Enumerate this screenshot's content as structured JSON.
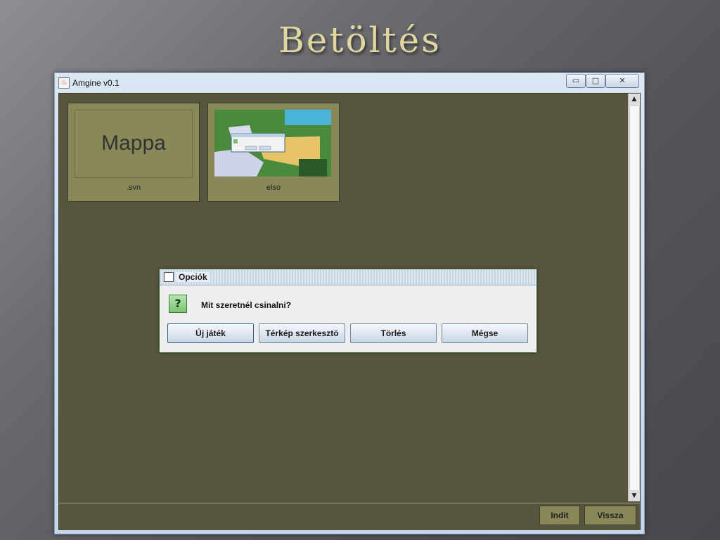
{
  "slide": {
    "title": "Betöltés"
  },
  "window": {
    "title": "Amgine v0.1",
    "minimize_glyph": "▭",
    "maximize_glyph": "□",
    "close_glyph": "✕"
  },
  "tiles": [
    {
      "image_text": "Mappa",
      "label": ".svn"
    },
    {
      "label": "elso"
    }
  ],
  "dialog": {
    "title": "Opciók",
    "icon": "question-icon",
    "icon_glyph": "?",
    "message": "Mit szeretnél csinalni?",
    "buttons": [
      "Új játék",
      "Térkép szerkesztö",
      "Törlés",
      "Mégse"
    ]
  },
  "footer": {
    "start": "Indit",
    "back": "Vissza"
  },
  "colors": {
    "client_bg": "#58553e",
    "tile_bg": "#898859",
    "title_text": "#e0d6a0"
  }
}
